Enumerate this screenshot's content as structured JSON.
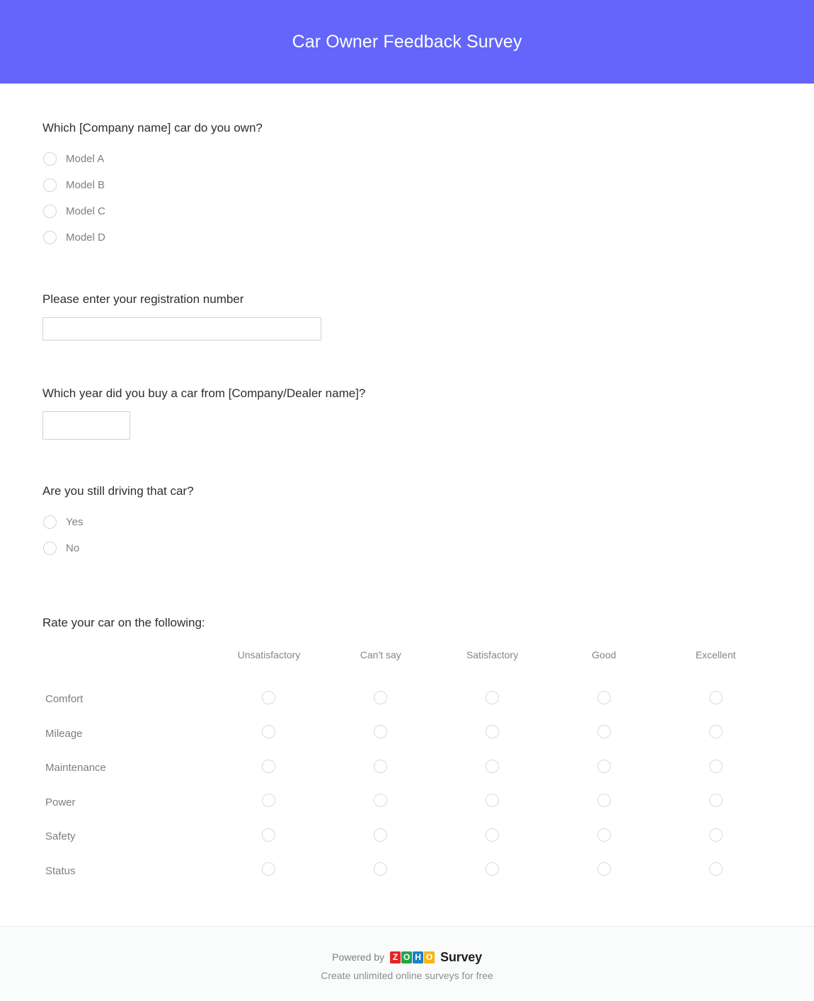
{
  "header": {
    "title": "Car Owner Feedback Survey",
    "background_color": "#6365fb",
    "text_color": "#ffffff"
  },
  "questions": {
    "model": {
      "text": "Which [Company name] car do you own?",
      "options": [
        "Model A",
        "Model B",
        "Model C",
        "Model D"
      ]
    },
    "registration": {
      "text": "Please enter your registration number",
      "value": "",
      "placeholder": ""
    },
    "purchase_year": {
      "text": "Which year did you buy a car from [Company/Dealer name]?",
      "value": "",
      "placeholder": ""
    },
    "still_driving": {
      "text": "Are you still driving that car?",
      "options": [
        "Yes",
        "No"
      ]
    },
    "rating_matrix": {
      "text": "Rate your car on the following:",
      "columns": [
        "Unsatisfactory",
        "Can't say",
        "Satisfactory",
        "Good",
        "Excellent"
      ],
      "rows": [
        "Comfort",
        "Mileage",
        "Maintenance",
        "Power",
        "Safety",
        "Status"
      ]
    }
  },
  "footer": {
    "powered_by": "Powered by",
    "brand_tiles": [
      "Z",
      "O",
      "H",
      "O"
    ],
    "brand_product": "Survey",
    "tagline": "Create unlimited online surveys for free"
  }
}
